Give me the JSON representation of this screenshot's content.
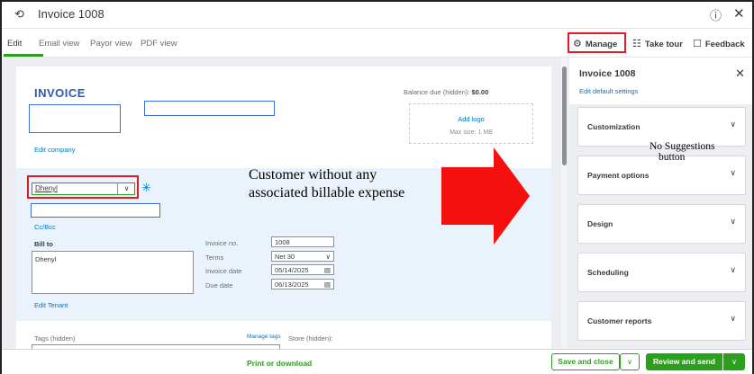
{
  "window": {
    "title": "Invoice 1008"
  },
  "tabs": [
    "Edit",
    "Email view",
    "Payor view",
    "PDF view"
  ],
  "toolbar": {
    "manage": "Manage",
    "take_tour": "Take tour",
    "feedback": "Feedback"
  },
  "invoice": {
    "heading": "INVOICE",
    "balance_label": "Balance due (hidden):",
    "balance_value": "$0.00",
    "add_logo": "Add logo",
    "max_size": "Max size: 1 MB",
    "edit_company": "Edit company",
    "customer_value": "Dhenyl",
    "cc_bcc": "Cc/Bcc",
    "bill_to_label": "Bill to",
    "bill_to_value": "Dhenyl",
    "edit_tenant": "Edit Tenant",
    "invoice_no_label": "Invoice no.",
    "invoice_no_value": "1008",
    "terms_label": "Terms",
    "terms_value": "Net 30",
    "invoice_date_label": "Invoice date",
    "invoice_date_value": "05/14/2025",
    "due_date_label": "Due date",
    "due_date_value": "06/13/2025",
    "tags_label": "Tags (hidden)",
    "manage_tags": "Manage tags",
    "store_label": "Store (hidden):"
  },
  "annotations": {
    "customer_note_line1": "Customer without any",
    "customer_note_line2": "associated billable expense",
    "no_suggestions_line1": "No Suggestions",
    "no_suggestions_line2": "button"
  },
  "sidebar": {
    "title": "Invoice 1008",
    "edit_defaults": "Edit default settings",
    "panels": [
      "Customization",
      "Payment options",
      "Design",
      "Scheduling",
      "Customer reports"
    ]
  },
  "footer": {
    "print_download": "Print or download",
    "save_close": "Save and close",
    "review_send": "Review and send"
  },
  "colors": {
    "accent": "#2ca01c",
    "link": "#0077c5",
    "highlight": "#e01b22"
  }
}
